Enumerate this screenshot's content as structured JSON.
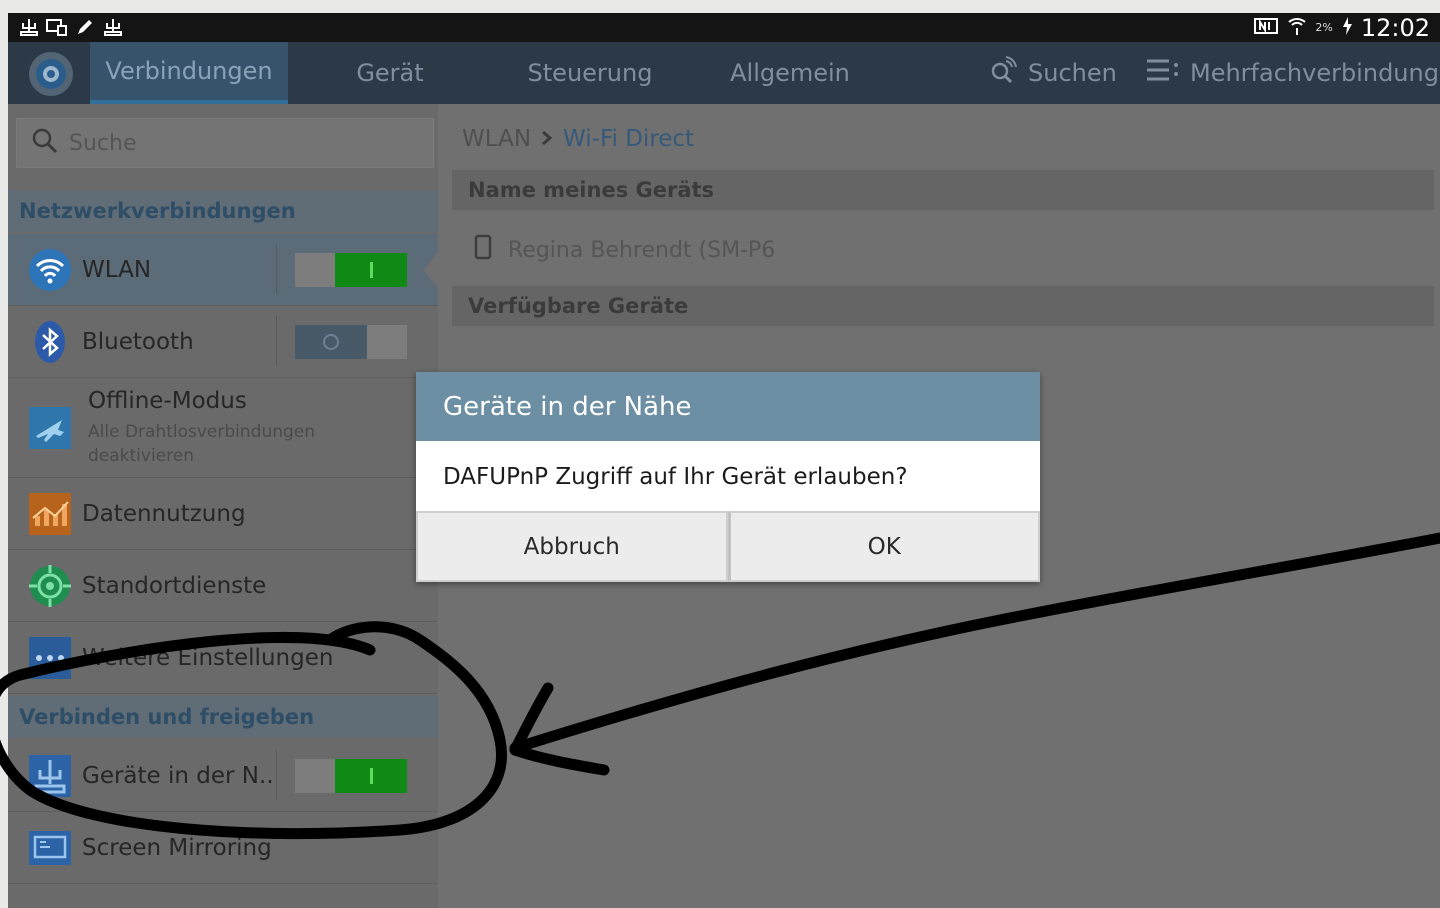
{
  "statusbar": {
    "time": "12:02",
    "battery": "2%",
    "left_icons": [
      "usb-icon",
      "screen-icon",
      "pen-icon",
      "usb-icon"
    ]
  },
  "tabs": [
    {
      "label": "Verbindungen",
      "active": true
    },
    {
      "label": "Gerät",
      "active": false
    },
    {
      "label": "Steuerung",
      "active": false
    },
    {
      "label": "Allgemein",
      "active": false
    }
  ],
  "actions": {
    "search": "Suchen",
    "multi": "Mehrfachverbindung"
  },
  "sidebar": {
    "search_placeholder": "Suche",
    "section1": "Netzwerkverbindungen",
    "wlan": "WLAN",
    "bluetooth": "Bluetooth",
    "offline_title": "Offline-Modus",
    "offline_sub1": "Alle Drahtlosverbindungen",
    "offline_sub2": "deaktivieren",
    "data_usage": "Datennutzung",
    "location": "Standortdienste",
    "more_settings": "Weitere Einstellungen",
    "section2": "Verbinden und freigeben",
    "nearby": "Geräte in der N..",
    "screen_mirroring": "Screen Mirroring",
    "toggles": {
      "wlan": true,
      "bluetooth": false,
      "nearby": true
    }
  },
  "content": {
    "breadcrumb_parent": "WLAN",
    "breadcrumb_current": "Wi-Fi Direct",
    "section_name": "Name meines Geräts",
    "device_name": "Regina Behrendt (SM-P6",
    "section_available": "Verfügbare Geräte"
  },
  "dialog": {
    "title": "Geräte in der Nähe",
    "message": "DAFUPnP Zugriff auf Ihr Gerät erlauben?",
    "cancel": "Abbruch",
    "ok": "OK"
  },
  "colors": {
    "toggle_on": "#108a14",
    "dialog_title": "#6c8fa3",
    "tabbar": "#2c3a48"
  }
}
